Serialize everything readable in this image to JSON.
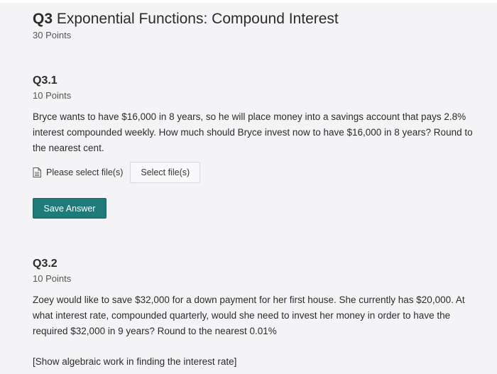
{
  "question": {
    "number": "Q3",
    "title": "Exponential Functions: Compound Interest",
    "points": "30 Points"
  },
  "parts": [
    {
      "title": "Q3.1",
      "points": "10 Points",
      "prompt": "Bryce wants to have $16,000 in 8 years, so he will place money into a savings account that pays 2.8% interest compounded weekly. How much should Bryce invest now to have $16,000 in 8 years? Round to the nearest cent.",
      "file_label": "Please select file(s)",
      "file_button": "Select file(s)",
      "save_button": "Save Answer"
    },
    {
      "title": "Q3.2",
      "points": "10 Points",
      "prompt": "Zoey would like to save $32,000 for a down payment for her first house.  She currently has $20,000.  At what interest rate, compounded quarterly, would she need to invest her money in order to have the required $32,000 in 9 years? Round to the nearest 0.01%",
      "note": "[Show algebraic work in finding the interest rate]"
    }
  ],
  "colors": {
    "accent": "#1f7a7a",
    "background": "#f4f4f7"
  }
}
